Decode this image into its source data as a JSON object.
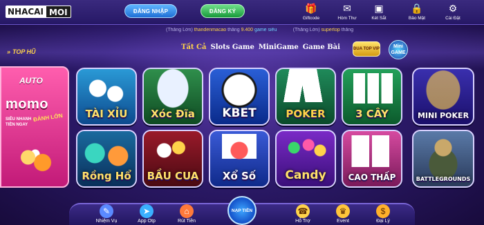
{
  "brand": {
    "part1": "NHACAI",
    "part2": "MOI"
  },
  "auth": {
    "login_label": "ĐĂNG NHẬP",
    "register_label": "ĐĂNG KÝ"
  },
  "top_actions": [
    {
      "label": "Giftcode",
      "icon": "gift-icon"
    },
    {
      "label": "Hòm Thư",
      "icon": "mail-icon"
    },
    {
      "label": "Két Sắt",
      "icon": "safe-icon"
    },
    {
      "label": "Bảo Mật",
      "icon": "lock-icon"
    },
    {
      "label": "Cài Đặt",
      "icon": "gear-icon"
    }
  ],
  "ticker": {
    "a_prefix": "(Thắng Lớn)",
    "a_user": "thandenmacao",
    "a_mid": "thắng",
    "a_amount": "9.400",
    "a_game": "game siêu",
    "b_prefix": "(Thắng Lớn)",
    "b_user": "supertop",
    "b_suffix": "thắng"
  },
  "top_hu_label": "TOP HŨ",
  "filters": [
    "Tất Cả",
    "Slots Game",
    "MiniGame",
    "Game Bài"
  ],
  "badges": {
    "vip": "ĐUA TOP VIP",
    "mini": "Mini GAME"
  },
  "promo": {
    "auto": "AUTO",
    "brand": "momo",
    "line1": "SIÊU NHANH",
    "line2": "ĐÁNH LỚN",
    "line3": "TIỀN NGAY"
  },
  "games_row1": [
    "TÀI XỈU",
    "Xóc Đĩa",
    "KBET",
    "POKER",
    "3 CÂY",
    "MINI POKER"
  ],
  "games_row2": [
    "Rồng Hổ",
    "BẦU CUA",
    "Xổ Số",
    "Candy",
    "CAO THẤP",
    "BATTLEGROUNDS"
  ],
  "bottom_nav": {
    "left": [
      {
        "label": "Nhiệm Vụ",
        "icon": "task-icon"
      },
      {
        "label": "App Otp",
        "icon": "send-icon"
      },
      {
        "label": "Rút Tiền",
        "icon": "cart-icon"
      }
    ],
    "center": "NẠP TIỀN",
    "right": [
      {
        "label": "Hỗ Trợ",
        "icon": "phone-icon"
      },
      {
        "label": "Event",
        "icon": "trophy-icon"
      },
      {
        "label": "Đại Lý",
        "icon": "coin-icon"
      }
    ]
  },
  "colors": {
    "accent": "#ffd34a",
    "bg": "#2c1a6a"
  }
}
